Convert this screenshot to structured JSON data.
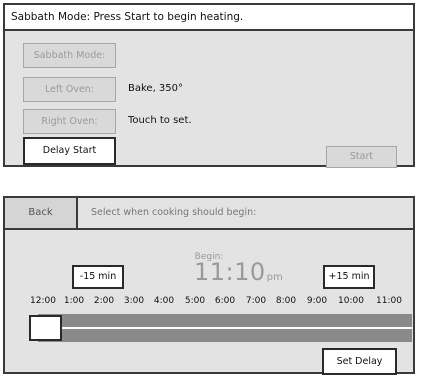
{
  "sabbath_panel": {
    "status_text": "Sabbath Mode: Press Start to begin heating.",
    "buttons": {
      "sabbath_mode": "Sabbath Mode:",
      "left_oven": "Left Oven:",
      "right_oven": "Right Oven:",
      "delay_start": "Delay Start",
      "start": "Start"
    },
    "values": {
      "left_oven": "Bake, 350°",
      "right_oven": "Touch to set."
    }
  },
  "delay_panel": {
    "back_label": "Back",
    "title": "Select when cooking should begin:",
    "begin_label": "Begin:",
    "begin_time": "11:10",
    "begin_ampm": "pm",
    "minus_label": "-15 min",
    "plus_label": "+15 min",
    "ticks": [
      "12:00",
      "1:00",
      "2:00",
      "3:00",
      "4:00",
      "5:00",
      "6:00",
      "7:00",
      "8:00",
      "9:00",
      "10:00",
      "11:00"
    ],
    "set_delay_label": "Set Delay"
  }
}
